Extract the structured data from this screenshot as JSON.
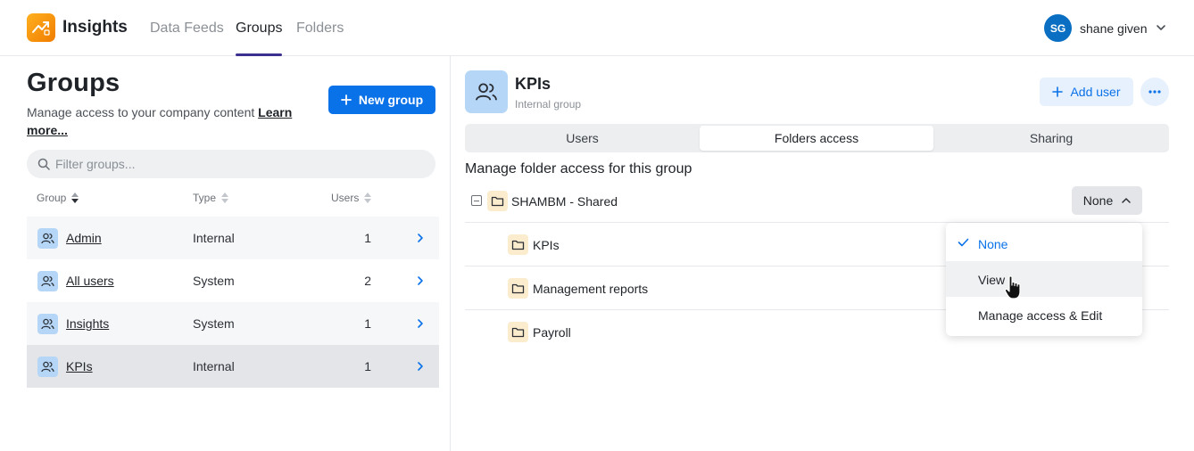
{
  "app": {
    "name": "Insights"
  },
  "nav": {
    "tabs": [
      {
        "label": "Data Feeds",
        "active": false
      },
      {
        "label": "Groups",
        "active": true
      },
      {
        "label": "Folders",
        "active": false
      }
    ]
  },
  "user": {
    "initials": "SG",
    "name": "shane given"
  },
  "groups_panel": {
    "title": "Groups",
    "description": "Manage access to your company content",
    "learn_more": "Learn more...",
    "new_group_label": "New group",
    "filter_placeholder": "Filter groups...",
    "columns": {
      "group": "Group",
      "type": "Type",
      "users": "Users"
    },
    "rows": [
      {
        "name": "Admin",
        "type": "Internal",
        "users": "1"
      },
      {
        "name": "All users",
        "type": "System",
        "users": "2"
      },
      {
        "name": "Insights",
        "type": "System",
        "users": "1"
      },
      {
        "name": "KPIs",
        "type": "Internal",
        "users": "1"
      }
    ]
  },
  "detail": {
    "title": "KPIs",
    "subtitle": "Internal group",
    "add_user_label": "Add user",
    "tabs": [
      {
        "label": "Users",
        "active": false
      },
      {
        "label": "Folders access",
        "active": true
      },
      {
        "label": "Sharing",
        "active": false
      }
    ],
    "manage_title": "Manage folder access for this group",
    "root_folder": {
      "name": "SHAMBM - Shared",
      "access": "None"
    },
    "subfolders": [
      {
        "name": "KPIs"
      },
      {
        "name": "Management reports"
      },
      {
        "name": "Payroll"
      }
    ],
    "dropdown": {
      "options": [
        {
          "label": "None",
          "checked": true
        },
        {
          "label": "View",
          "checked": false
        },
        {
          "label": "Manage access & Edit",
          "checked": false
        }
      ]
    }
  },
  "colors": {
    "primary": "#0a72e8",
    "nav_underline": "#3b2f8f",
    "avatar": "#0a6fc2",
    "group_icon_bg": "#b6d6f7",
    "folder_icon_bg": "#fbeccd"
  }
}
